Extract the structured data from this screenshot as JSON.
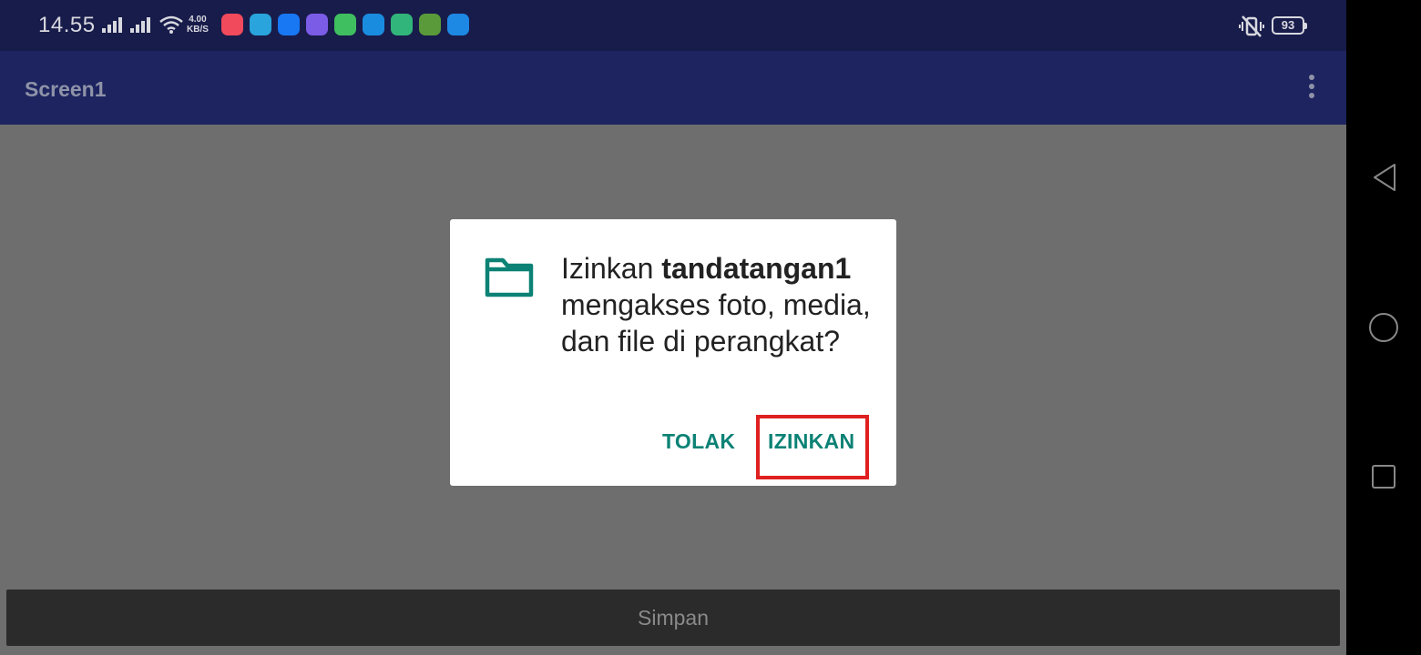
{
  "status_bar": {
    "time": "14.55",
    "net_speed_value": "4.00",
    "net_speed_unit": "KB/S",
    "battery": "93",
    "app_icons": [
      "music-icon",
      "telegram-icon",
      "facebook-icon",
      "pin-icon",
      "chat-icon",
      "browser-icon",
      "grocery-icon",
      "owl-icon",
      "hotspot-icon"
    ],
    "icon_colors": [
      "#f04a5c",
      "#2aa4dc",
      "#1877f2",
      "#7b5ce6",
      "#3fbf5f",
      "#1a8ce0",
      "#31b57a",
      "#5a9a3a",
      "#1e88e5"
    ]
  },
  "appbar": {
    "title": "Screen1"
  },
  "dialog": {
    "prefix": "Izinkan ",
    "app_name": "tandatangan1",
    "suffix": " mengakses foto, media, dan file di perangkat?",
    "deny_label": "TOLAK",
    "allow_label": "IZINKAN"
  },
  "bottom": {
    "save_label": "Simpan"
  },
  "colors": {
    "accent": "#0b8275",
    "highlight": "#e02020",
    "appbar": "#1d2460",
    "statusbar": "#181c4a"
  }
}
